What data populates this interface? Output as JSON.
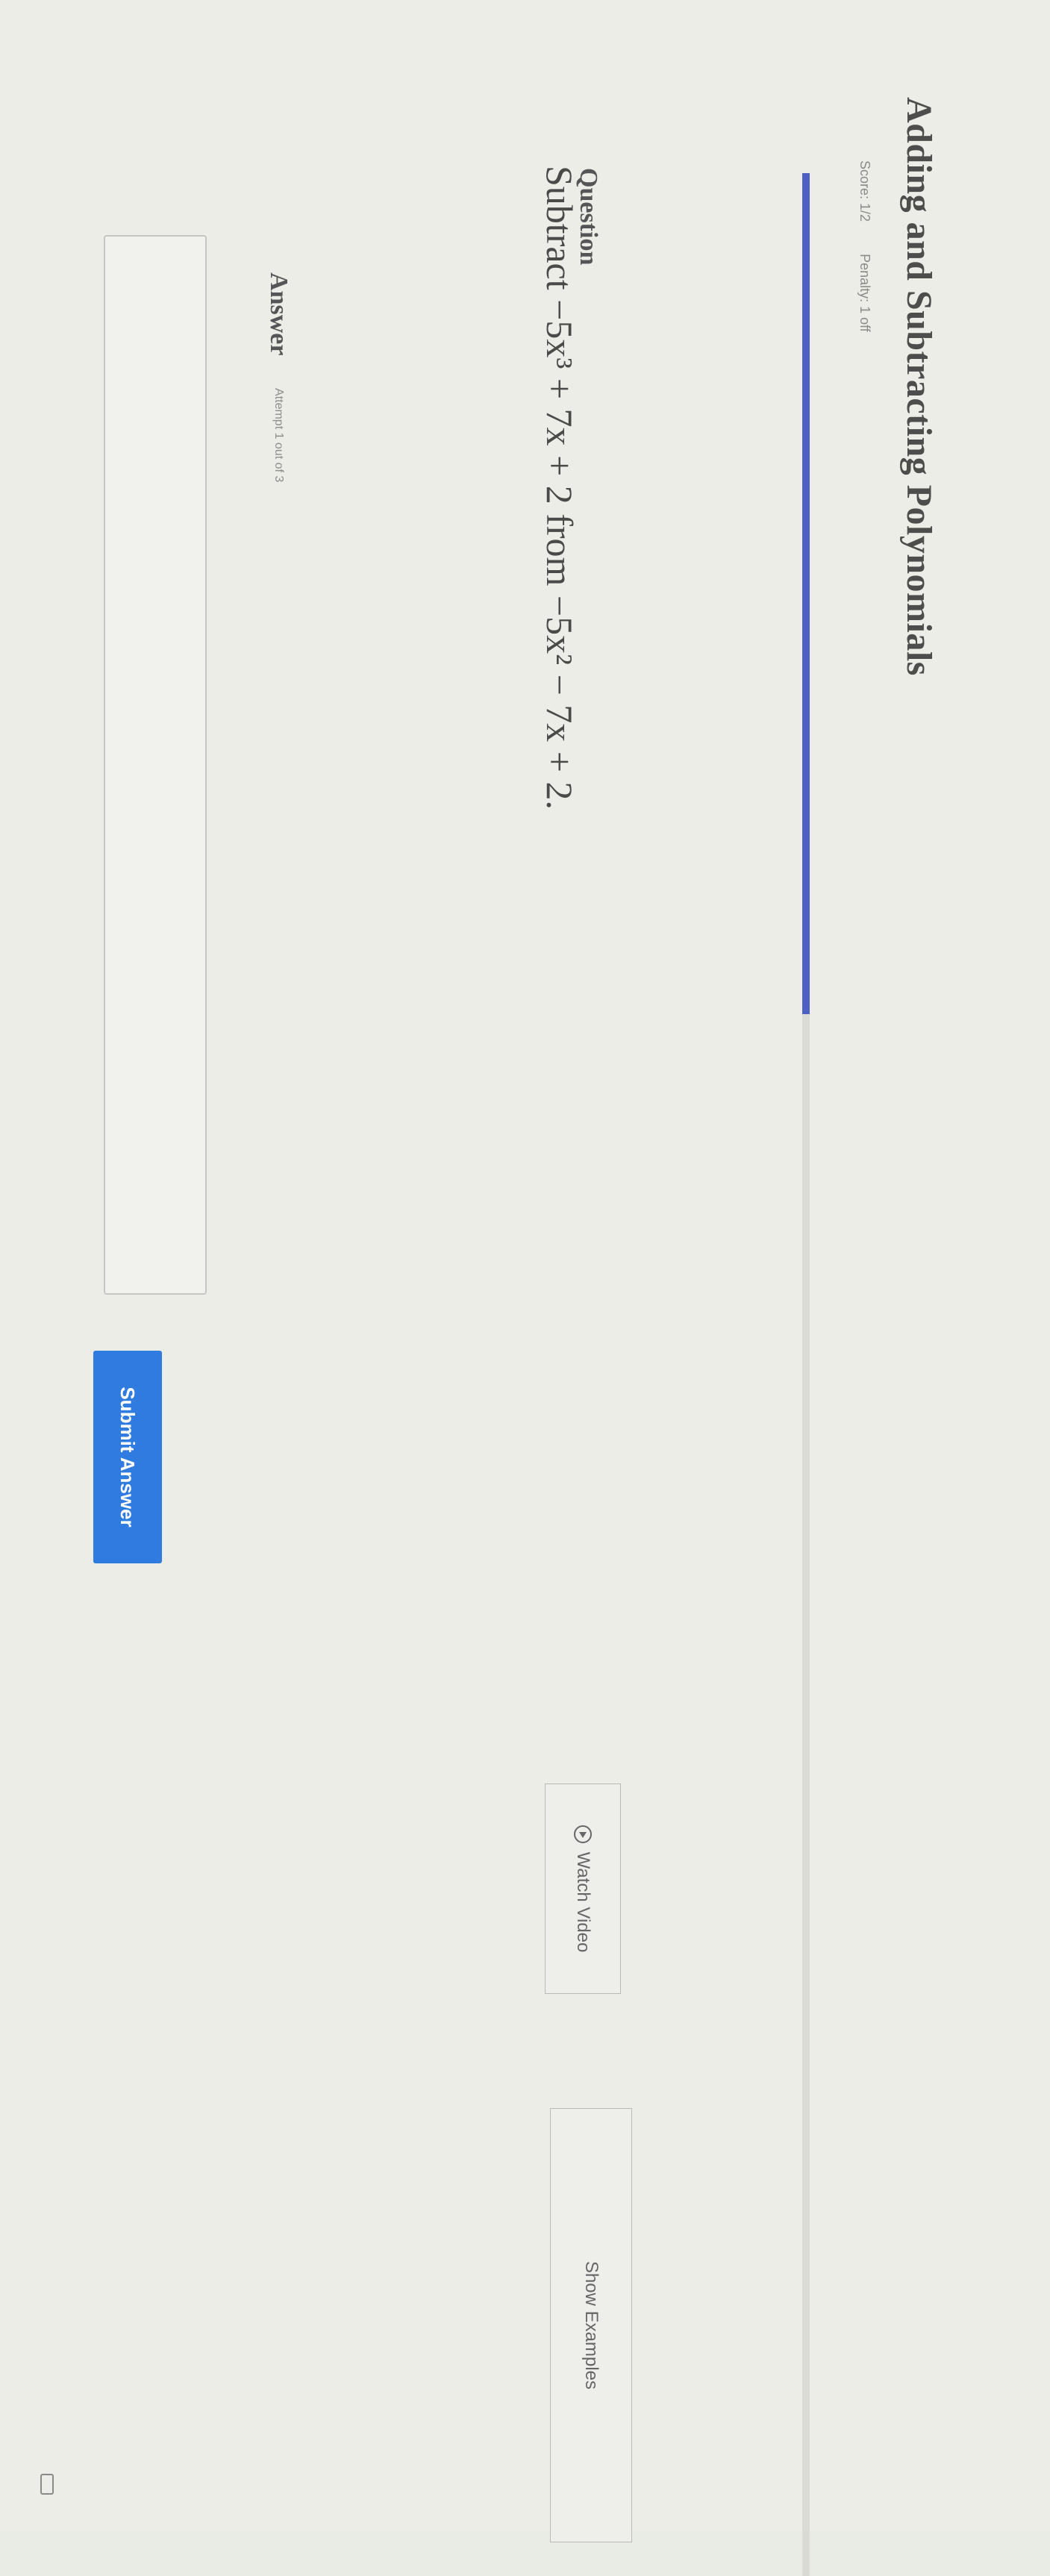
{
  "page": {
    "title": "Adding and Subtracting Polynomials",
    "score": "Score: 1/2",
    "penalty": "Penalty: 1 off",
    "progress_fraction": 0.35
  },
  "question": {
    "label": "Question",
    "text": "Subtract −5x³ + 7x + 2 from −5x² − 7x + 2."
  },
  "buttons": {
    "watch_video": "Watch Video",
    "show_examples": "Show Examples",
    "submit": "Submit Answer"
  },
  "answer": {
    "label": "Answer",
    "attempt": "Attempt 1 out of 3",
    "input_value": ""
  },
  "icons": {
    "play": "play-circle-icon",
    "keyboard": "keyboard-icon"
  },
  "colors": {
    "progress": "#4e5fc4",
    "submit": "#2f7be0"
  }
}
